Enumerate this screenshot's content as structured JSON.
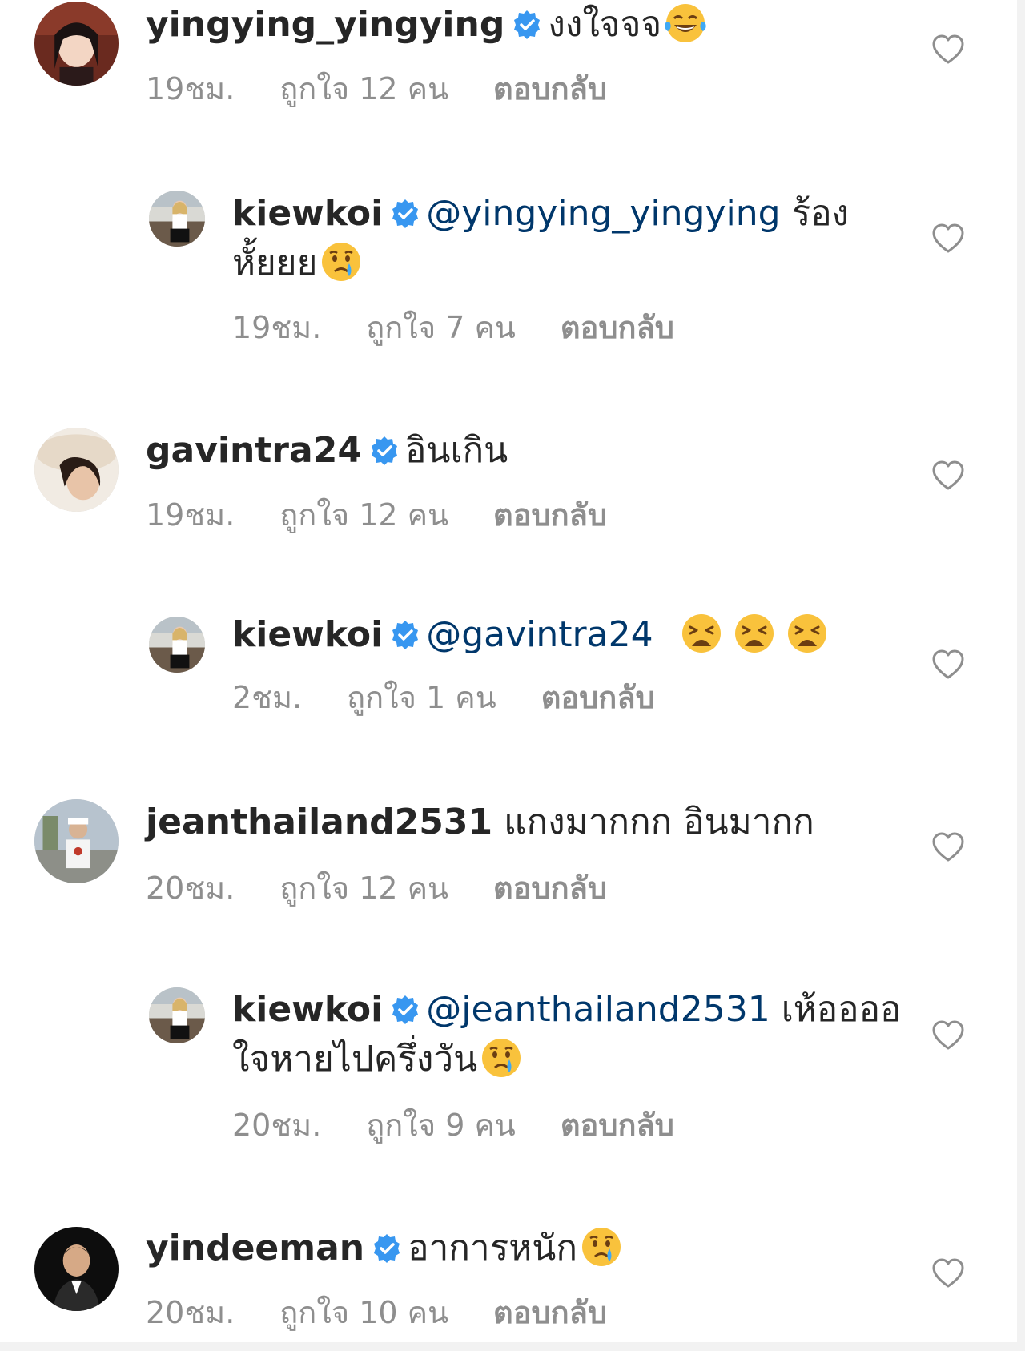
{
  "comments": [
    {
      "username": "yingying_yingying",
      "verified": true,
      "mention": "",
      "text_line1": "งงใจจจ",
      "text_line2": "",
      "emoji": "laughing-tears-emoji",
      "time": "19ชม.",
      "likes": "ถูกใจ 12 คน",
      "reply": "ตอบกลับ",
      "is_reply": false
    },
    {
      "username": "kiewkoi",
      "verified": true,
      "mention": "@yingying_yingying",
      "text_line1": "ร้อง",
      "text_line2": "หั้ยยย",
      "emoji": "crying-emoji",
      "time": "19ชม.",
      "likes": "ถูกใจ 7 คน",
      "reply": "ตอบกลับ",
      "is_reply": true
    },
    {
      "username": "gavintra24",
      "verified": true,
      "mention": "",
      "text_line1": "อินเกิน",
      "text_line2": "",
      "emoji": "",
      "time": "19ชม.",
      "likes": "ถูกใจ 12 คน",
      "reply": "ตอบกลับ",
      "is_reply": false
    },
    {
      "username": "kiewkoi",
      "verified": true,
      "mention": "@gavintra24",
      "text_line1": "",
      "text_line2": "",
      "emoji": "weary-emoji",
      "time": "2ชม.",
      "likes": "ถูกใจ 1 คน",
      "reply": "ตอบกลับ",
      "is_reply": true
    },
    {
      "username": "jeanthailand2531",
      "verified": false,
      "mention": "",
      "text_line1": "แกงมากกก อินมากก",
      "text_line2": "",
      "emoji": "",
      "time": "20ชม.",
      "likes": "ถูกใจ 12 คน",
      "reply": "ตอบกลับ",
      "is_reply": false
    },
    {
      "username": "kiewkoi",
      "verified": true,
      "mention": "@jeanthailand2531",
      "text_line1": "เห้ออออ",
      "text_line2": "ใจหายไปครึ่งวัน",
      "emoji": "crying-emoji",
      "time": "20ชม.",
      "likes": "ถูกใจ 9 คน",
      "reply": "ตอบกลับ",
      "is_reply": true
    },
    {
      "username": "yindeeman",
      "verified": true,
      "mention": "",
      "text_line1": "อาการหนัก",
      "text_line2": "",
      "emoji": "crying-emoji",
      "time": "20ชม.",
      "likes": "ถูกใจ 10 คน",
      "reply": "ตอบกลับ",
      "is_reply": false
    }
  ],
  "colors": {
    "username": "#262626",
    "mention": "#00376b",
    "meta": "#8e8e8e",
    "verified_badge": "#3897f0",
    "like_icon": "#8e8e8e"
  }
}
